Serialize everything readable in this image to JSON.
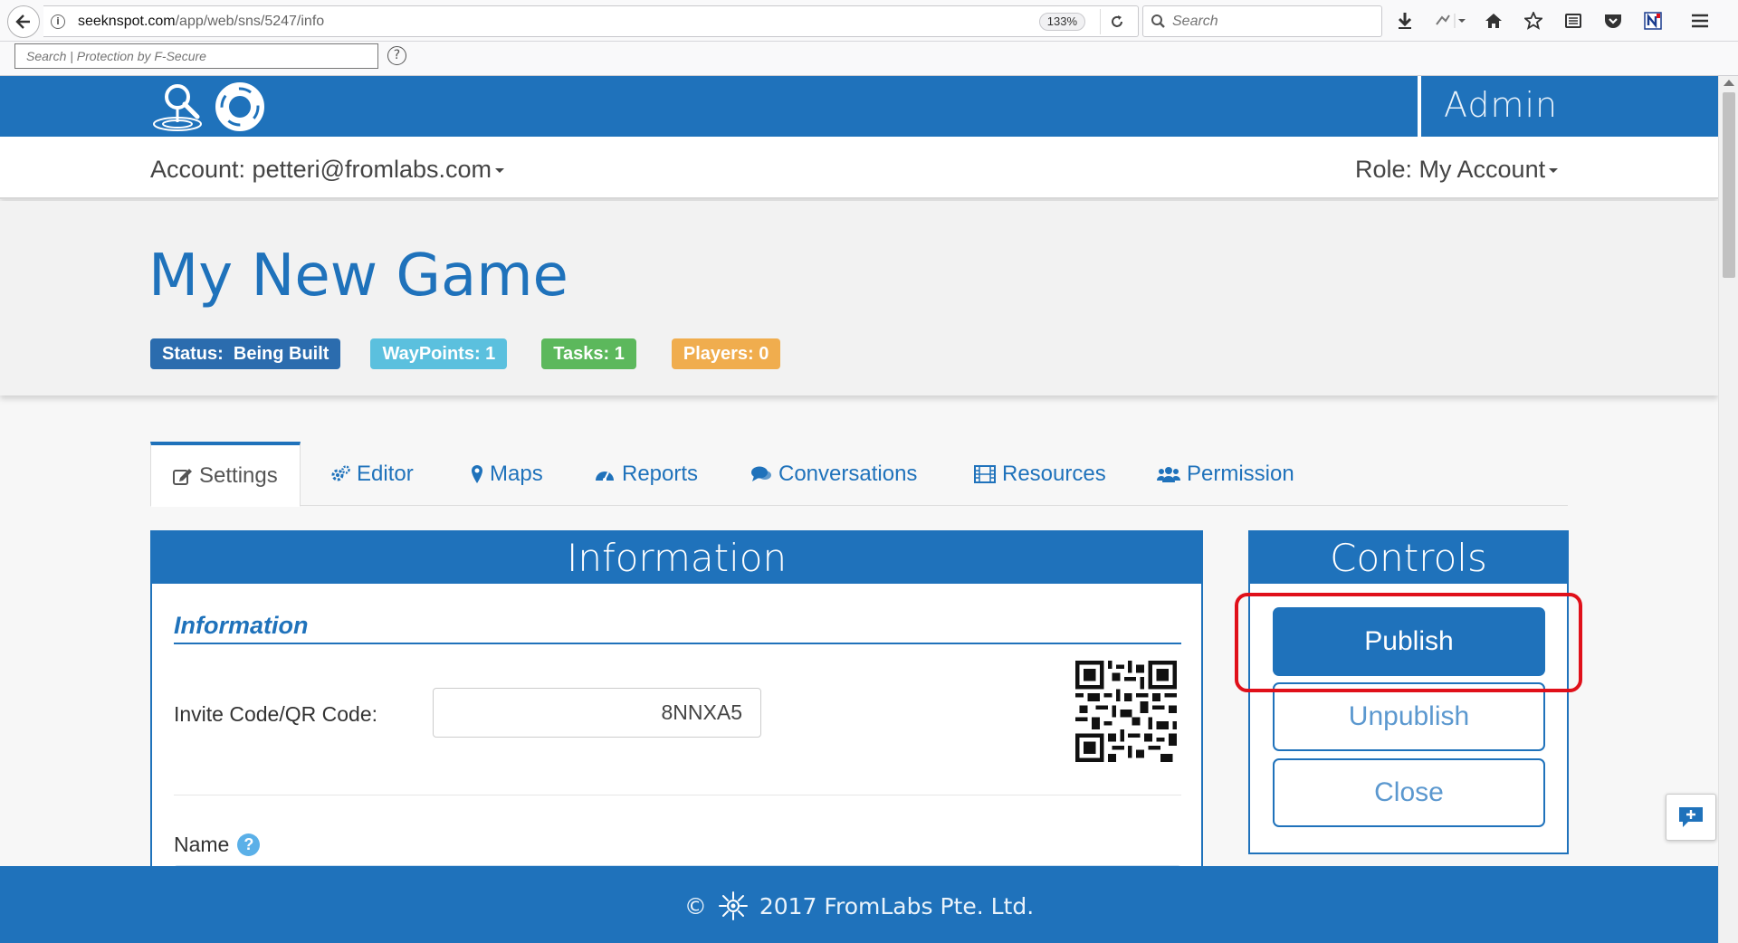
{
  "browser": {
    "url_host": "seeknspot.com",
    "url_path": "/app/web/sns/5247/info",
    "zoom": "133%",
    "search_placeholder": "Search",
    "security_search_placeholder": "Search | Protection by F-Secure",
    "help_glyph": "?",
    "info_glyph": "i"
  },
  "header": {
    "admin_label": "Admin"
  },
  "account": {
    "account_label": "Account: petteri@fromlabs.com",
    "role_label": "Role: My Account"
  },
  "game": {
    "title": "My New Game",
    "badges": {
      "status": "Status:  Being Built",
      "waypoints": "WayPoints: 1",
      "tasks": "Tasks: 1",
      "players": "Players: 0"
    }
  },
  "tabs": [
    {
      "label": "Settings",
      "icon": "edit-icon"
    },
    {
      "label": "Editor",
      "icon": "gears-icon"
    },
    {
      "label": "Maps",
      "icon": "map-marker-icon"
    },
    {
      "label": "Reports",
      "icon": "dashboard-icon"
    },
    {
      "label": "Conversations",
      "icon": "comments-icon"
    },
    {
      "label": "Resources",
      "icon": "film-icon"
    },
    {
      "label": "Permission",
      "icon": "users-icon"
    }
  ],
  "info_panel": {
    "heading": "Information",
    "subheading": "Information",
    "invite_label": "Invite Code/QR Code:",
    "invite_code": "8NNXA5",
    "name_label": "Name",
    "help_glyph": "?"
  },
  "controls": {
    "heading": "Controls",
    "publish": "Publish",
    "unpublish": "Unpublish",
    "close": "Close"
  },
  "footer": {
    "copyright_symbol": "©",
    "text": "2017 FromLabs Pte. Ltd."
  },
  "colors": {
    "brand_blue": "#1f72bb",
    "status_badge": "#2b6cae",
    "waypoints_badge": "#5bc0de",
    "tasks_badge": "#5cb85c",
    "players_badge": "#f0ad4e",
    "highlight_red": "#e0101a"
  }
}
